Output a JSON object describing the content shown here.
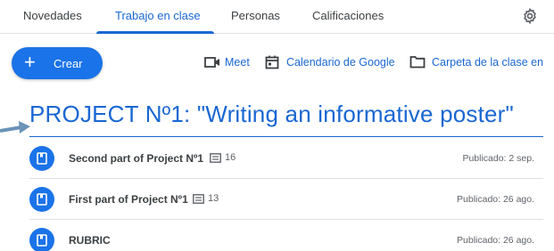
{
  "nav": {
    "tabs": [
      {
        "label": "Novedades"
      },
      {
        "label": "Trabajo en clase",
        "active": true
      },
      {
        "label": "Personas"
      },
      {
        "label": "Calificaciones"
      }
    ],
    "settings_icon": "gear-icon"
  },
  "toolbar": {
    "create_label": "Crear",
    "create_icon": "plus-icon",
    "links": [
      {
        "label": "Meet",
        "icon": "video-camera-icon"
      },
      {
        "label": "Calendario de Google",
        "icon": "calendar-icon"
      },
      {
        "label": "Carpeta de la clase en",
        "icon": "folder-icon"
      }
    ]
  },
  "topic": {
    "title": "PROJECT Nº1: \"Writing an informative poster\""
  },
  "assignments": [
    {
      "title": "Second part of Project Nº1",
      "comments": "16",
      "posted": "Publicado: 2 sep."
    },
    {
      "title": "First part of Project Nº1",
      "comments": "13",
      "posted": "Publicado: 26 ago."
    },
    {
      "title": "RUBRIC",
      "comments": "",
      "posted": "Publicado: 26 ago."
    }
  ],
  "colors": {
    "accent": "#1967d2",
    "button": "#1a73e8",
    "text": "#3c4043",
    "muted": "#5f6368",
    "divider": "#e0e0e0",
    "arrow": "#6b93b8"
  }
}
